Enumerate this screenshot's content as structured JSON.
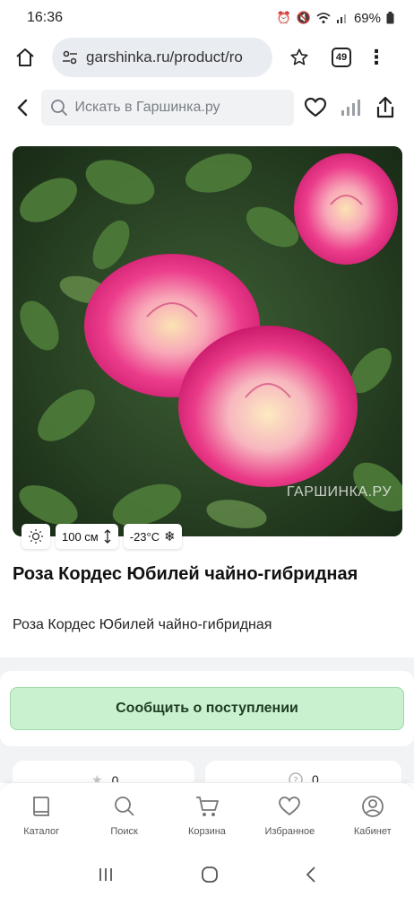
{
  "status_bar": {
    "time": "16:36",
    "battery": "69%"
  },
  "browser": {
    "url": "garshinka.ru/product/ro",
    "tab_count": "49"
  },
  "header": {
    "search_placeholder": "Искать в Гаршинка.ру"
  },
  "product": {
    "watermark": "ГАРШИНКА.РУ",
    "badges": {
      "height": "100 см",
      "frost": "-23°C"
    },
    "title": "Роза Кордес Юбилей чайно-гибридная",
    "subtitle": "Роза Кордес Юбилей чайно-гибридная",
    "notify_label": "Сообщить о поступлении",
    "rating_count": "0",
    "questions_count": "0"
  },
  "bottom_nav": {
    "items": [
      {
        "label": "Каталог",
        "icon": "book-icon"
      },
      {
        "label": "Поиск",
        "icon": "search-icon"
      },
      {
        "label": "Корзина",
        "icon": "cart-icon"
      },
      {
        "label": "Избранное",
        "icon": "heart-icon"
      },
      {
        "label": "Кабинет",
        "icon": "user-icon"
      }
    ]
  },
  "colors": {
    "notify_bg": "#c9f0cf",
    "notify_text": "#1f3d22",
    "rose_pink": "#e8287a"
  }
}
